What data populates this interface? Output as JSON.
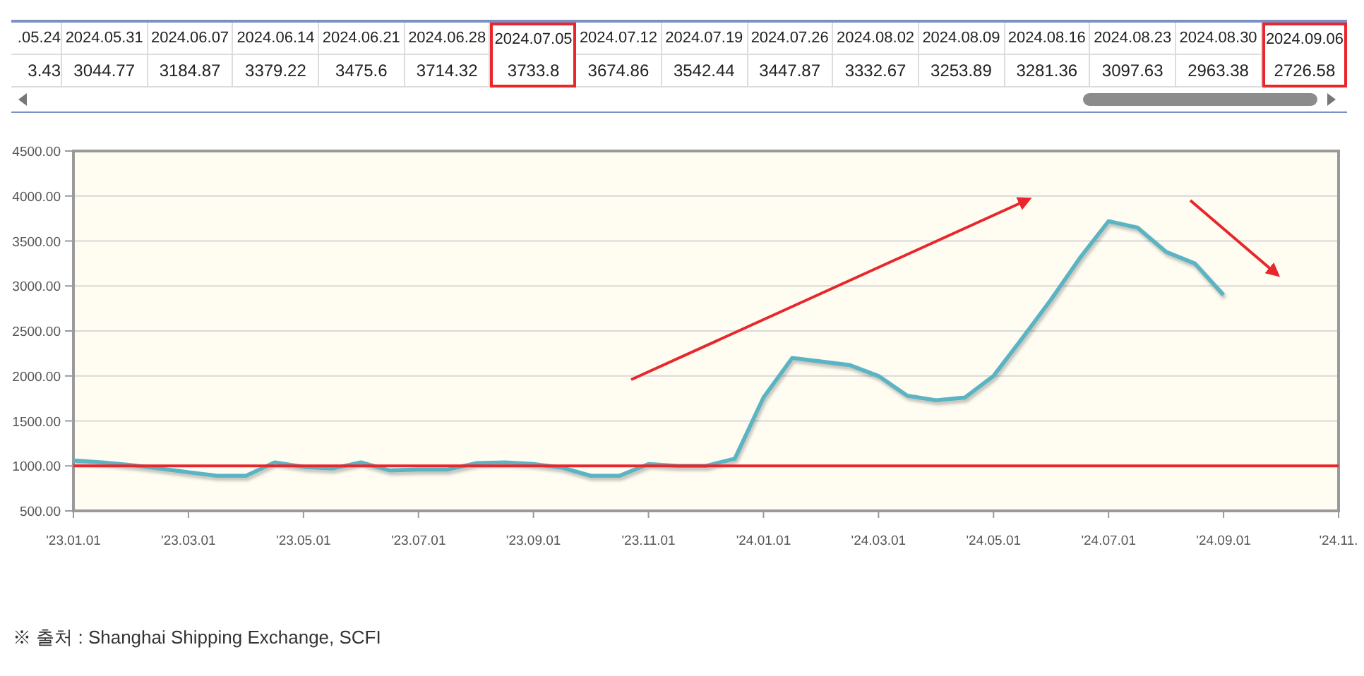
{
  "table": {
    "columns": [
      {
        "date": ".05.24",
        "value": "3.43",
        "highlighted": false
      },
      {
        "date": "2024.05.31",
        "value": "3044.77",
        "highlighted": false
      },
      {
        "date": "2024.06.07",
        "value": "3184.87",
        "highlighted": false
      },
      {
        "date": "2024.06.14",
        "value": "3379.22",
        "highlighted": false
      },
      {
        "date": "2024.06.21",
        "value": "3475.6",
        "highlighted": false
      },
      {
        "date": "2024.06.28",
        "value": "3714.32",
        "highlighted": false
      },
      {
        "date": "2024.07.05",
        "value": "3733.8",
        "highlighted": true
      },
      {
        "date": "2024.07.12",
        "value": "3674.86",
        "highlighted": false
      },
      {
        "date": "2024.07.19",
        "value": "3542.44",
        "highlighted": false
      },
      {
        "date": "2024.07.26",
        "value": "3447.87",
        "highlighted": false
      },
      {
        "date": "2024.08.02",
        "value": "3332.67",
        "highlighted": false
      },
      {
        "date": "2024.08.09",
        "value": "3253.89",
        "highlighted": false
      },
      {
        "date": "2024.08.16",
        "value": "3281.36",
        "highlighted": false
      },
      {
        "date": "2024.08.23",
        "value": "3097.63",
        "highlighted": false
      },
      {
        "date": "2024.08.30",
        "value": "2963.38",
        "highlighted": false
      },
      {
        "date": "2024.09.06",
        "value": "2726.58",
        "highlighted": true
      }
    ]
  },
  "chart": {
    "chart_data": {
      "type": "line",
      "categories": [
        "'23.01.01",
        null,
        null,
        null,
        "'23.03.01",
        null,
        null,
        null,
        "'23.05.01",
        null,
        null,
        null,
        "'23.07.01",
        null,
        null,
        null,
        "'23.09.01",
        null,
        null,
        null,
        "'23.11.01",
        null,
        null,
        null,
        "'24.01.01",
        null,
        null,
        null,
        "'24.03.01",
        null,
        null,
        null,
        "'24.05.01",
        null,
        null,
        null,
        "'24.07.01",
        null,
        null,
        null,
        "'24.09.01",
        null,
        null,
        null,
        "'24.11."
      ],
      "series": [
        {
          "color": "#5ab4c4",
          "values": [
            1060,
            1040,
            1010,
            970,
            930,
            890,
            890,
            1040,
            990,
            970,
            1040,
            950,
            960,
            960,
            1030,
            1040,
            1020,
            980,
            890,
            890,
            1020,
            1000,
            1000,
            1080,
            1760,
            2200,
            2160,
            2120,
            2000,
            1780,
            1730,
            1760,
            2000,
            2420,
            2850,
            3310,
            3720,
            3650,
            3380,
            3250,
            2900,
            null,
            null,
            null,
            null
          ]
        }
      ],
      "ylim": [
        500,
        4500
      ],
      "yticks": [
        {
          "value": 500,
          "label": "500.00"
        },
        {
          "value": 1000,
          "label": "1000.00"
        },
        {
          "value": 1500,
          "label": "1500.00"
        },
        {
          "value": 2000,
          "label": "2000.00"
        },
        {
          "value": 2500,
          "label": "2500.00"
        },
        {
          "value": 3000,
          "label": "3000.00"
        },
        {
          "value": 3500,
          "label": "3500.00"
        },
        {
          "value": 4000,
          "label": "4000.00"
        },
        {
          "value": 4500,
          "label": "4500.00"
        }
      ],
      "grid": true,
      "ref_lines": [
        {
          "axis": "y",
          "value": 1000
        }
      ]
    }
  },
  "source_note": "※ 출처 : Shanghai Shipping Exchange, SCFI"
}
